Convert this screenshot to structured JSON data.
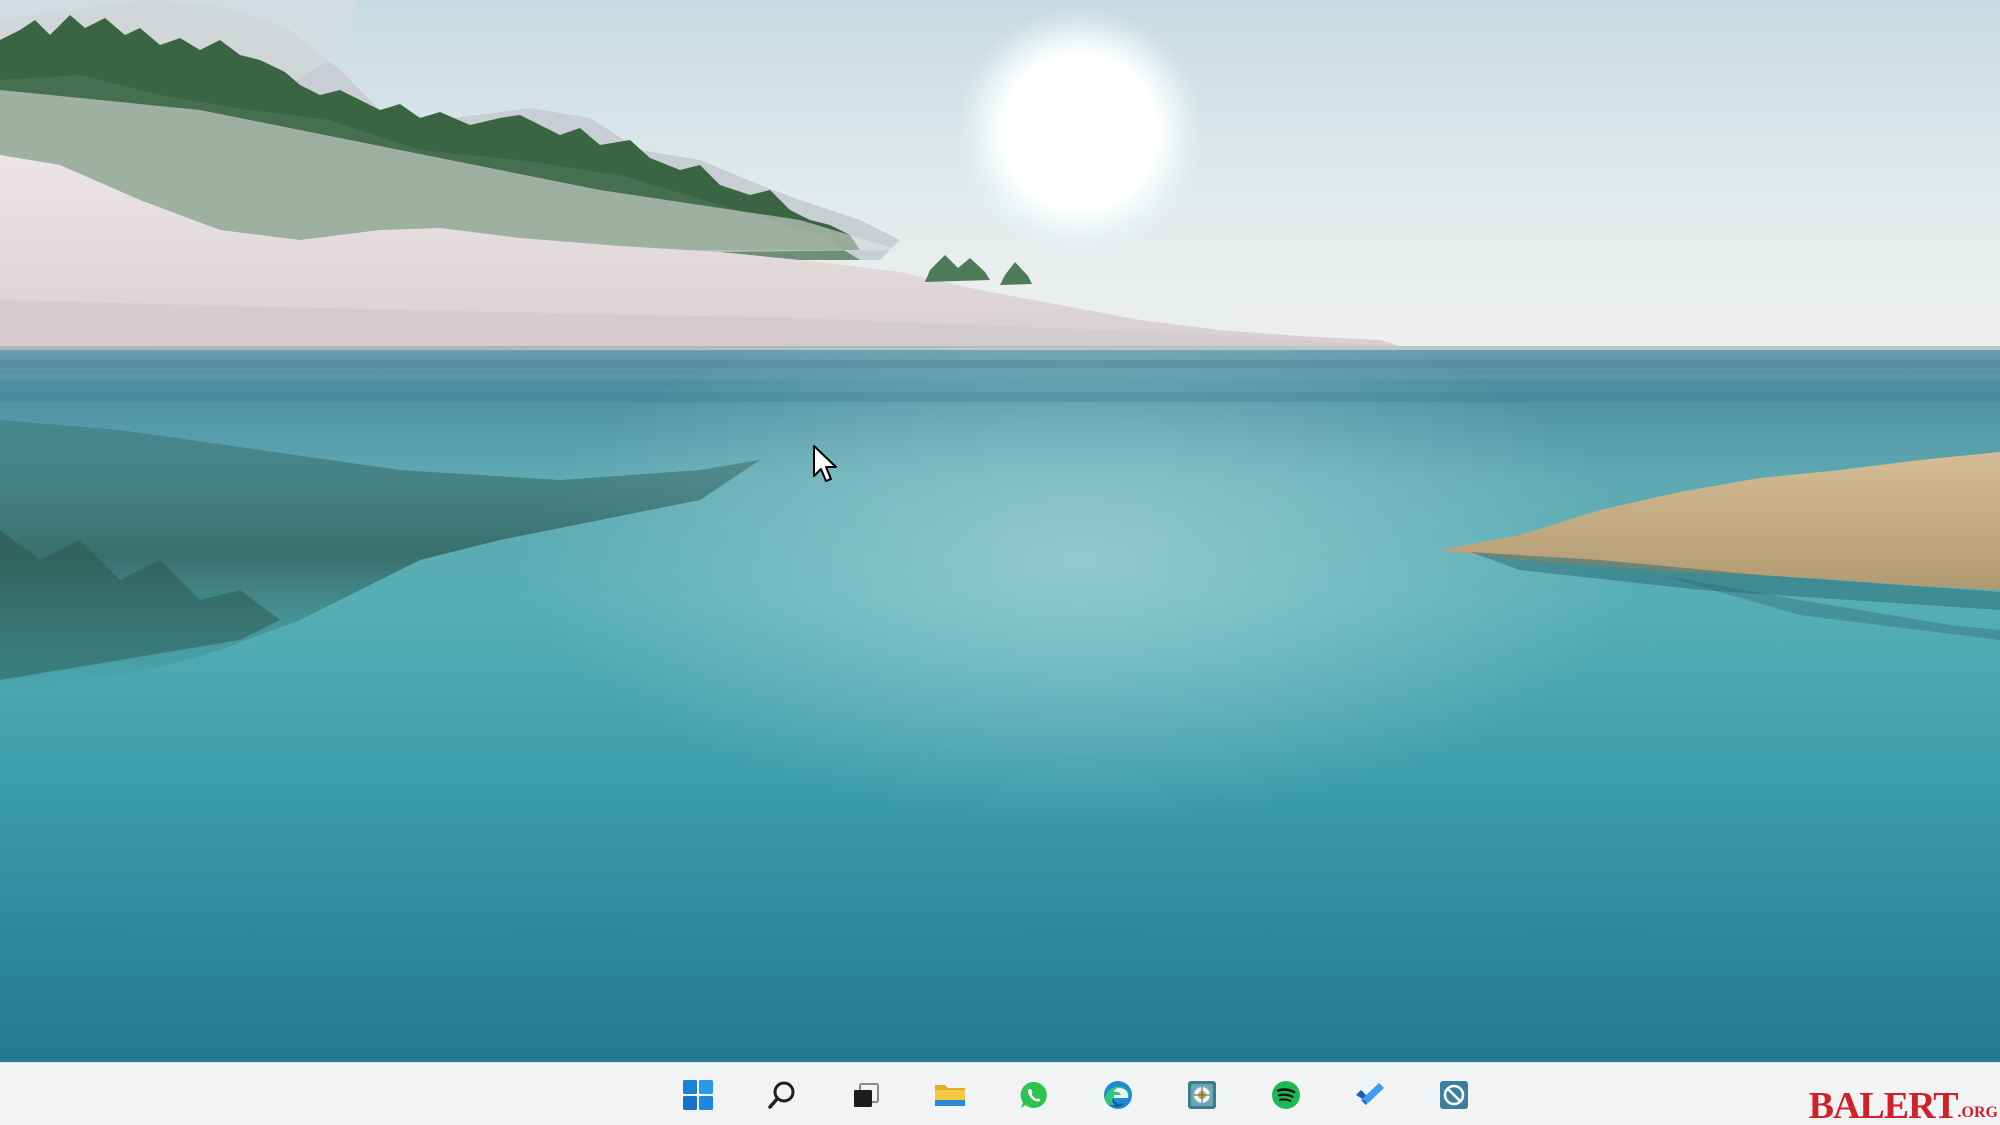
{
  "wallpaper": {
    "description_colors": {
      "sky_top": "#c9dde3",
      "sky_horizon": "#eef1f1",
      "water_far": "#5f9fae",
      "water_mid": "#3d9fab",
      "water_near": "#2a7f96",
      "grass": "#c5ae84",
      "hill": "#e6dada",
      "trees": "#2f5a3a"
    }
  },
  "taskbar": {
    "background": "#f2f3f5",
    "icons": [
      {
        "name": "start-icon"
      },
      {
        "name": "search-icon"
      },
      {
        "name": "task-view-icon"
      },
      {
        "name": "file-explorer-icon"
      },
      {
        "name": "whatsapp-icon"
      },
      {
        "name": "edge-icon"
      },
      {
        "name": "control-panel-icon"
      },
      {
        "name": "spotify-icon"
      },
      {
        "name": "todo-icon"
      },
      {
        "name": "app-icon"
      }
    ]
  },
  "watermark": {
    "main": "BALERT",
    "tld": ".ORG",
    "color": "#d0202a"
  }
}
